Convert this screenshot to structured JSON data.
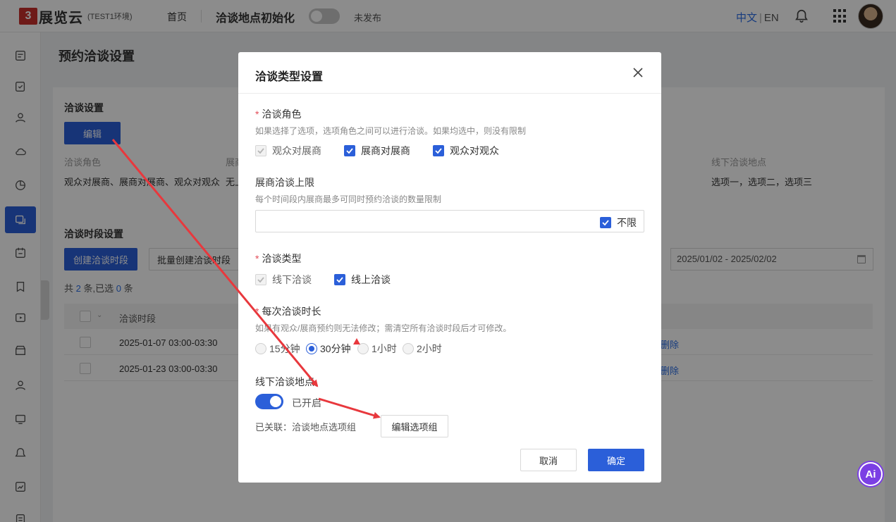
{
  "header": {
    "logo_mark": "3",
    "logo_text": "展览云",
    "env": "(TEST1环境)",
    "home": "首页",
    "page_title": "洽谈地点初始化",
    "publish_status": "未发布",
    "lang_zh": "中文",
    "lang_sep": "|",
    "lang_en": "EN"
  },
  "page": {
    "heading": "预约洽谈设置",
    "settings_title": "洽谈设置",
    "edit_btn": "编辑",
    "col_role": "洽谈角色",
    "col_limit_partial": "展商",
    "col_location": "线下洽谈地点",
    "role_value": "观众对展商、展商对展商、观众对观众",
    "limit_value_partial": "无上",
    "location_value": "选项一，选项二，选项三",
    "period_title": "洽谈时段设置",
    "create_btn": "创建洽谈时段",
    "batch_btn": "批量创建洽谈时段",
    "date_range": "2025/01/02 - 2025/02/02",
    "count_prefix": "共",
    "count_total": "2",
    "count_mid": "条,已选",
    "count_selected": "0",
    "count_suffix": "条",
    "th_period": "洽谈时段",
    "rows": [
      {
        "period": "2025-01-07 03:00-03:30",
        "action": "删除"
      },
      {
        "period": "2025-01-23 03:00-03:30",
        "action": "删除"
      }
    ]
  },
  "modal": {
    "title": "洽谈类型设置",
    "role_label": "洽谈角色",
    "role_help": "如果选择了选项，选项角色之间可以进行洽谈。如果均选中，则没有限制",
    "roles": [
      "观众对展商",
      "展商对展商",
      "观众对观众"
    ],
    "limit_label": "展商洽谈上限",
    "limit_help": "每个时间段内展商最多可同时预约洽谈的数量限制",
    "unlimited": "不限",
    "type_label": "洽谈类型",
    "types": [
      "线下洽谈",
      "线上洽谈"
    ],
    "duration_label": "每次洽谈时长",
    "duration_help": "如果有观众/展商预约则无法修改；需清空所有洽谈时段后才可修改。",
    "durations": [
      "15分钟",
      "30分钟",
      "1小时",
      "2小时"
    ],
    "offline_label": "线下洽谈地点",
    "toggle_label": "已开启",
    "linked_text": "已关联：洽谈地点选项组",
    "edit_group_btn": "编辑选项组",
    "cancel": "取消",
    "ok": "确定"
  },
  "ai_badge": "Ai",
  "colors": {
    "primary": "#2b5fd9",
    "arrow": "#e8383d",
    "required": "#e34d59"
  }
}
